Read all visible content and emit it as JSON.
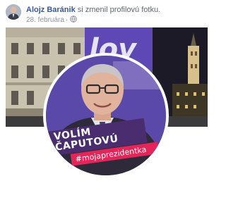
{
  "post": {
    "author": "Alojz Baránik",
    "action": "si zmenil profilovú fotku.",
    "date": "28. februára",
    "separator": "·",
    "privacy_icon": "globe-icon"
  },
  "photo": {
    "cover_background_text": "lov",
    "banner_line1": "VOLÍM",
    "banner_line2": "ČAPUTOVÚ",
    "hashtag": "#mojaprezidentka"
  },
  "colors": {
    "author_link": "#385898",
    "banner_purple": "#4a2d6e",
    "hashtag_red": "#e5245a",
    "frame_purple": "#5a49a8"
  }
}
